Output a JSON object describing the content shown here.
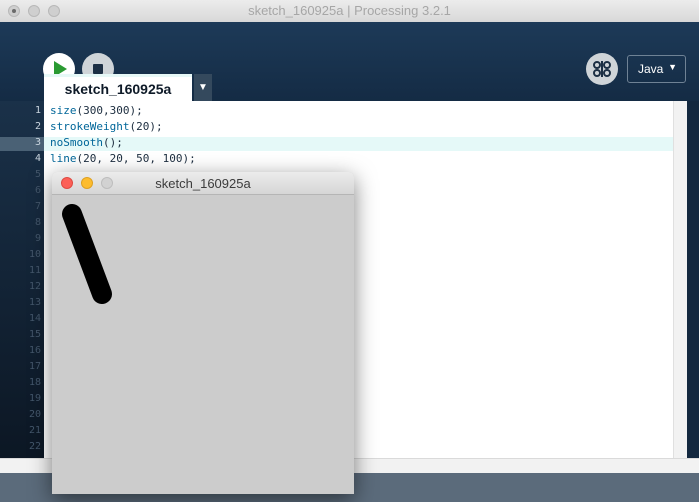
{
  "window": {
    "title": "sketch_160925a | Processing 3.2.1"
  },
  "toolbar": {
    "run_icon": "play-icon",
    "stop_icon": "stop-icon",
    "debug_icon": "butterfly-icon",
    "mode": "Java",
    "mode_arrow": "▼"
  },
  "tab": {
    "label": "sketch_160925a",
    "menu_arrow": "▼"
  },
  "editor": {
    "current_line": 3,
    "line_numbers": [
      "1",
      "2",
      "3",
      "4",
      "5",
      "6",
      "7",
      "8",
      "9",
      "10",
      "11",
      "12",
      "13",
      "14",
      "15",
      "16",
      "17",
      "18",
      "19",
      "20",
      "21",
      "22"
    ],
    "code": [
      {
        "fn": "size",
        "args": "(300,300);"
      },
      {
        "fn": "strokeWeight",
        "args": "(20);"
      },
      {
        "fn": "noSmooth",
        "args": "();"
      },
      {
        "fn": "line",
        "args": "(20, 20, 50, 100);"
      }
    ]
  },
  "sketch_window": {
    "title": "sketch_160925a",
    "background": "#cccccc"
  },
  "colors": {
    "toolbar": "#1d3a58",
    "run_green": "#2a9a32",
    "function_blue": "#006699",
    "current_line": "#e5f9f8"
  }
}
